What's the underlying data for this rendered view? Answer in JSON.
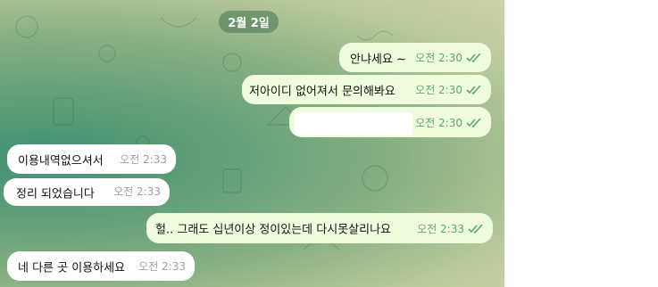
{
  "date_pill": "2월 2일",
  "messages": [
    {
      "text": "안냐세요 ~",
      "time": "오전 2:30"
    },
    {
      "text": "저아이디 없어져서 문의해봐요",
      "time": "오전 2:30"
    },
    {
      "text": "",
      "time": "오전 2:30"
    },
    {
      "text": "이용내역없으셔서",
      "time": "오전 2:33"
    },
    {
      "text": "정리 되었습니다",
      "time": "오전 2:33"
    },
    {
      "text": "헐.. 그래도 십년이상 정이있는데 다시못살리나요",
      "time": "오전 2:33"
    },
    {
      "text": "네 다른 곳 이용하세요",
      "time": "오전 2:33"
    }
  ],
  "colors": {
    "outgoing_bubble": "#effdde",
    "incoming_bubble": "#ffffff",
    "read_ticks": "#5fa86a"
  },
  "icons": {
    "read_status": "double-check-icon"
  }
}
